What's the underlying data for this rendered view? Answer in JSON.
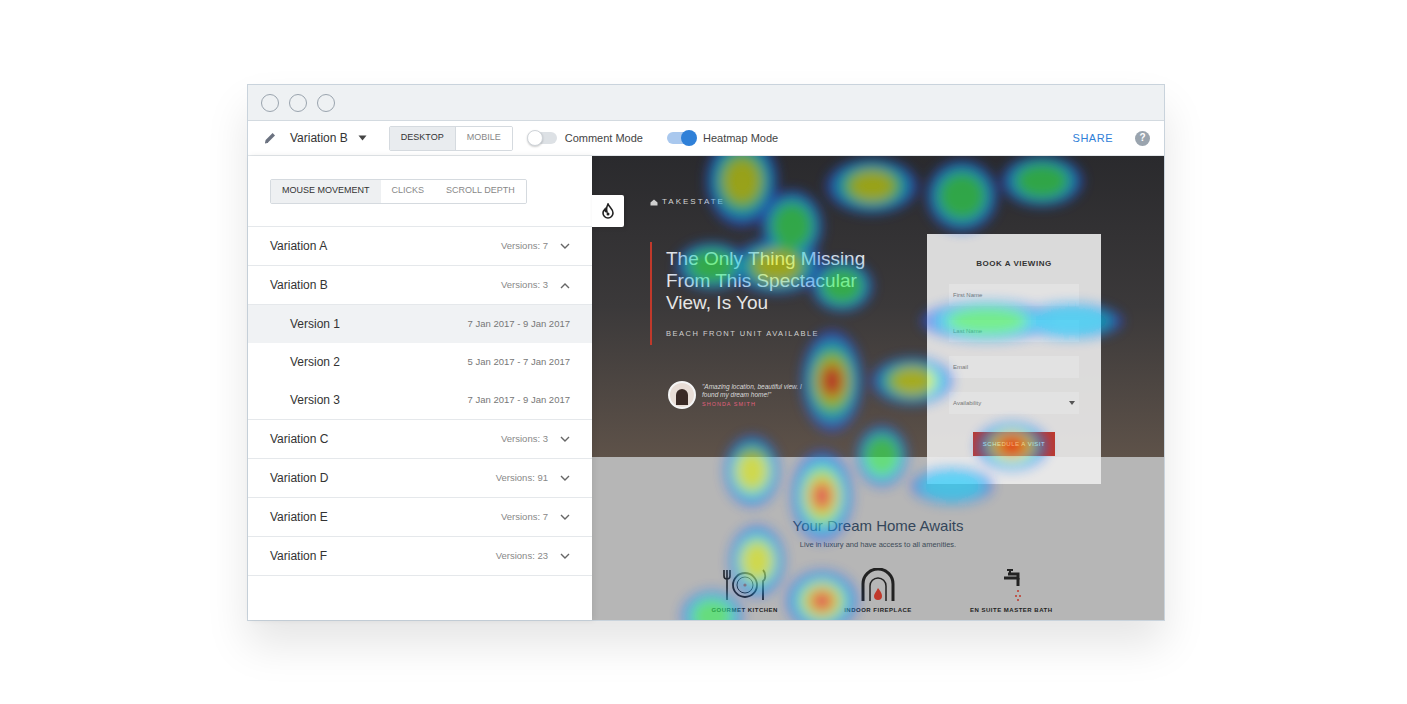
{
  "toolbar": {
    "variation": "Variation B",
    "devices": [
      {
        "label": "DESKTOP",
        "selected": true
      },
      {
        "label": "MOBILE",
        "selected": false
      }
    ],
    "toggles": [
      {
        "label": "Comment Mode",
        "on": false
      },
      {
        "label": "Heatmap Mode",
        "on": true
      }
    ],
    "share": "SHARE",
    "help": "?"
  },
  "panel": {
    "tabs": [
      {
        "label": "MOUSE MOVEMENT",
        "selected": true
      },
      {
        "label": "CLICKS",
        "selected": false
      },
      {
        "label": "SCROLL DEPTH",
        "selected": false
      }
    ],
    "variations": [
      {
        "name": "Variation A",
        "versions_label": "Versions: 7",
        "expanded": false
      },
      {
        "name": "Variation B",
        "versions_label": "Versions: 3",
        "expanded": true,
        "versions": [
          {
            "name": "Version 1",
            "dates": "7 Jan 2017 - 9 Jan 2017",
            "selected": true
          },
          {
            "name": "Version 2",
            "dates": "5 Jan 2017 - 7 Jan 2017",
            "selected": false
          },
          {
            "name": "Version 3",
            "dates": "7 Jan 2017 - 9 Jan 2017",
            "selected": false
          }
        ]
      },
      {
        "name": "Variation C",
        "versions_label": "Versions: 3",
        "expanded": false
      },
      {
        "name": "Variation D",
        "versions_label": "Versions: 91",
        "expanded": false
      },
      {
        "name": "Variation E",
        "versions_label": "Versions: 7",
        "expanded": false
      },
      {
        "name": "Variation F",
        "versions_label": "Versions: 23",
        "expanded": false
      }
    ]
  },
  "page": {
    "logo": "TAKESTATE",
    "headline": "The Only Thing Missing From This Spectacular View, Is You",
    "tagline": "BEACH FRONT UNIT AVAILABLE",
    "testimonial": {
      "quote": "\"Amazing location, beautiful view. I found my dream home!\"",
      "author": "SHONDA SMITH"
    },
    "form": {
      "title": "BOOK A VIEWING",
      "fields": [
        {
          "placeholder": "First Name",
          "kind": "text"
        },
        {
          "placeholder": "Last Name",
          "kind": "text"
        },
        {
          "placeholder": "Email",
          "kind": "text"
        },
        {
          "placeholder": "Availability",
          "kind": "select"
        }
      ],
      "button": "SCHEDULE A VISIT"
    },
    "section": {
      "heading": "Your Dream Home Awaits",
      "subheading": "Live in luxury and have access to all amenities.",
      "features": [
        {
          "label": "GOURMET KITCHEN"
        },
        {
          "label": "INDOOR FIREPLACE"
        },
        {
          "label": "EN SUITE MASTER BATH"
        }
      ]
    }
  }
}
